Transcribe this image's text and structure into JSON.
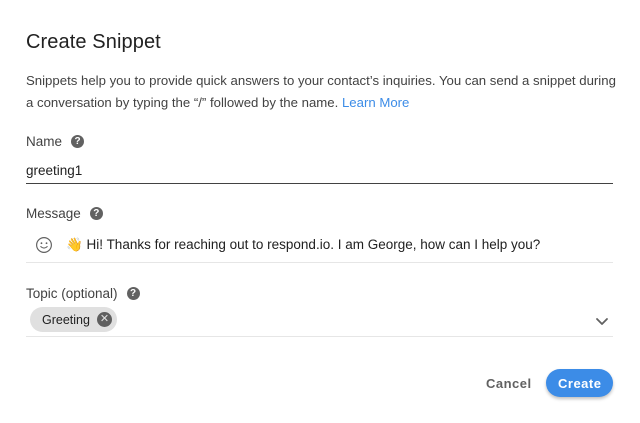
{
  "dialog": {
    "title": "Create Snippet",
    "description": "Snippets help you to provide quick answers to your contact’s inquiries. You can send a snippet during a conversation by typing the “/” followed by the name.",
    "learn_more": "Learn More"
  },
  "name_field": {
    "label": "Name",
    "value": "greeting1"
  },
  "message_field": {
    "label": "Message",
    "value": "👋 Hi! Thanks for reaching out to respond.io. I am George, how can I help you?"
  },
  "topic_field": {
    "label": "Topic (optional)",
    "chips": [
      "Greeting"
    ]
  },
  "actions": {
    "cancel_label": "Cancel",
    "create_label": "Create"
  },
  "colors": {
    "accent": "#3c8ce7",
    "chip_bg": "#e0e0e0"
  },
  "icons": {
    "help": "help-circle-icon",
    "emoji": "smiley-face-icon",
    "chip_remove": "close-circle-icon",
    "dropdown": "chevron-down-icon"
  }
}
